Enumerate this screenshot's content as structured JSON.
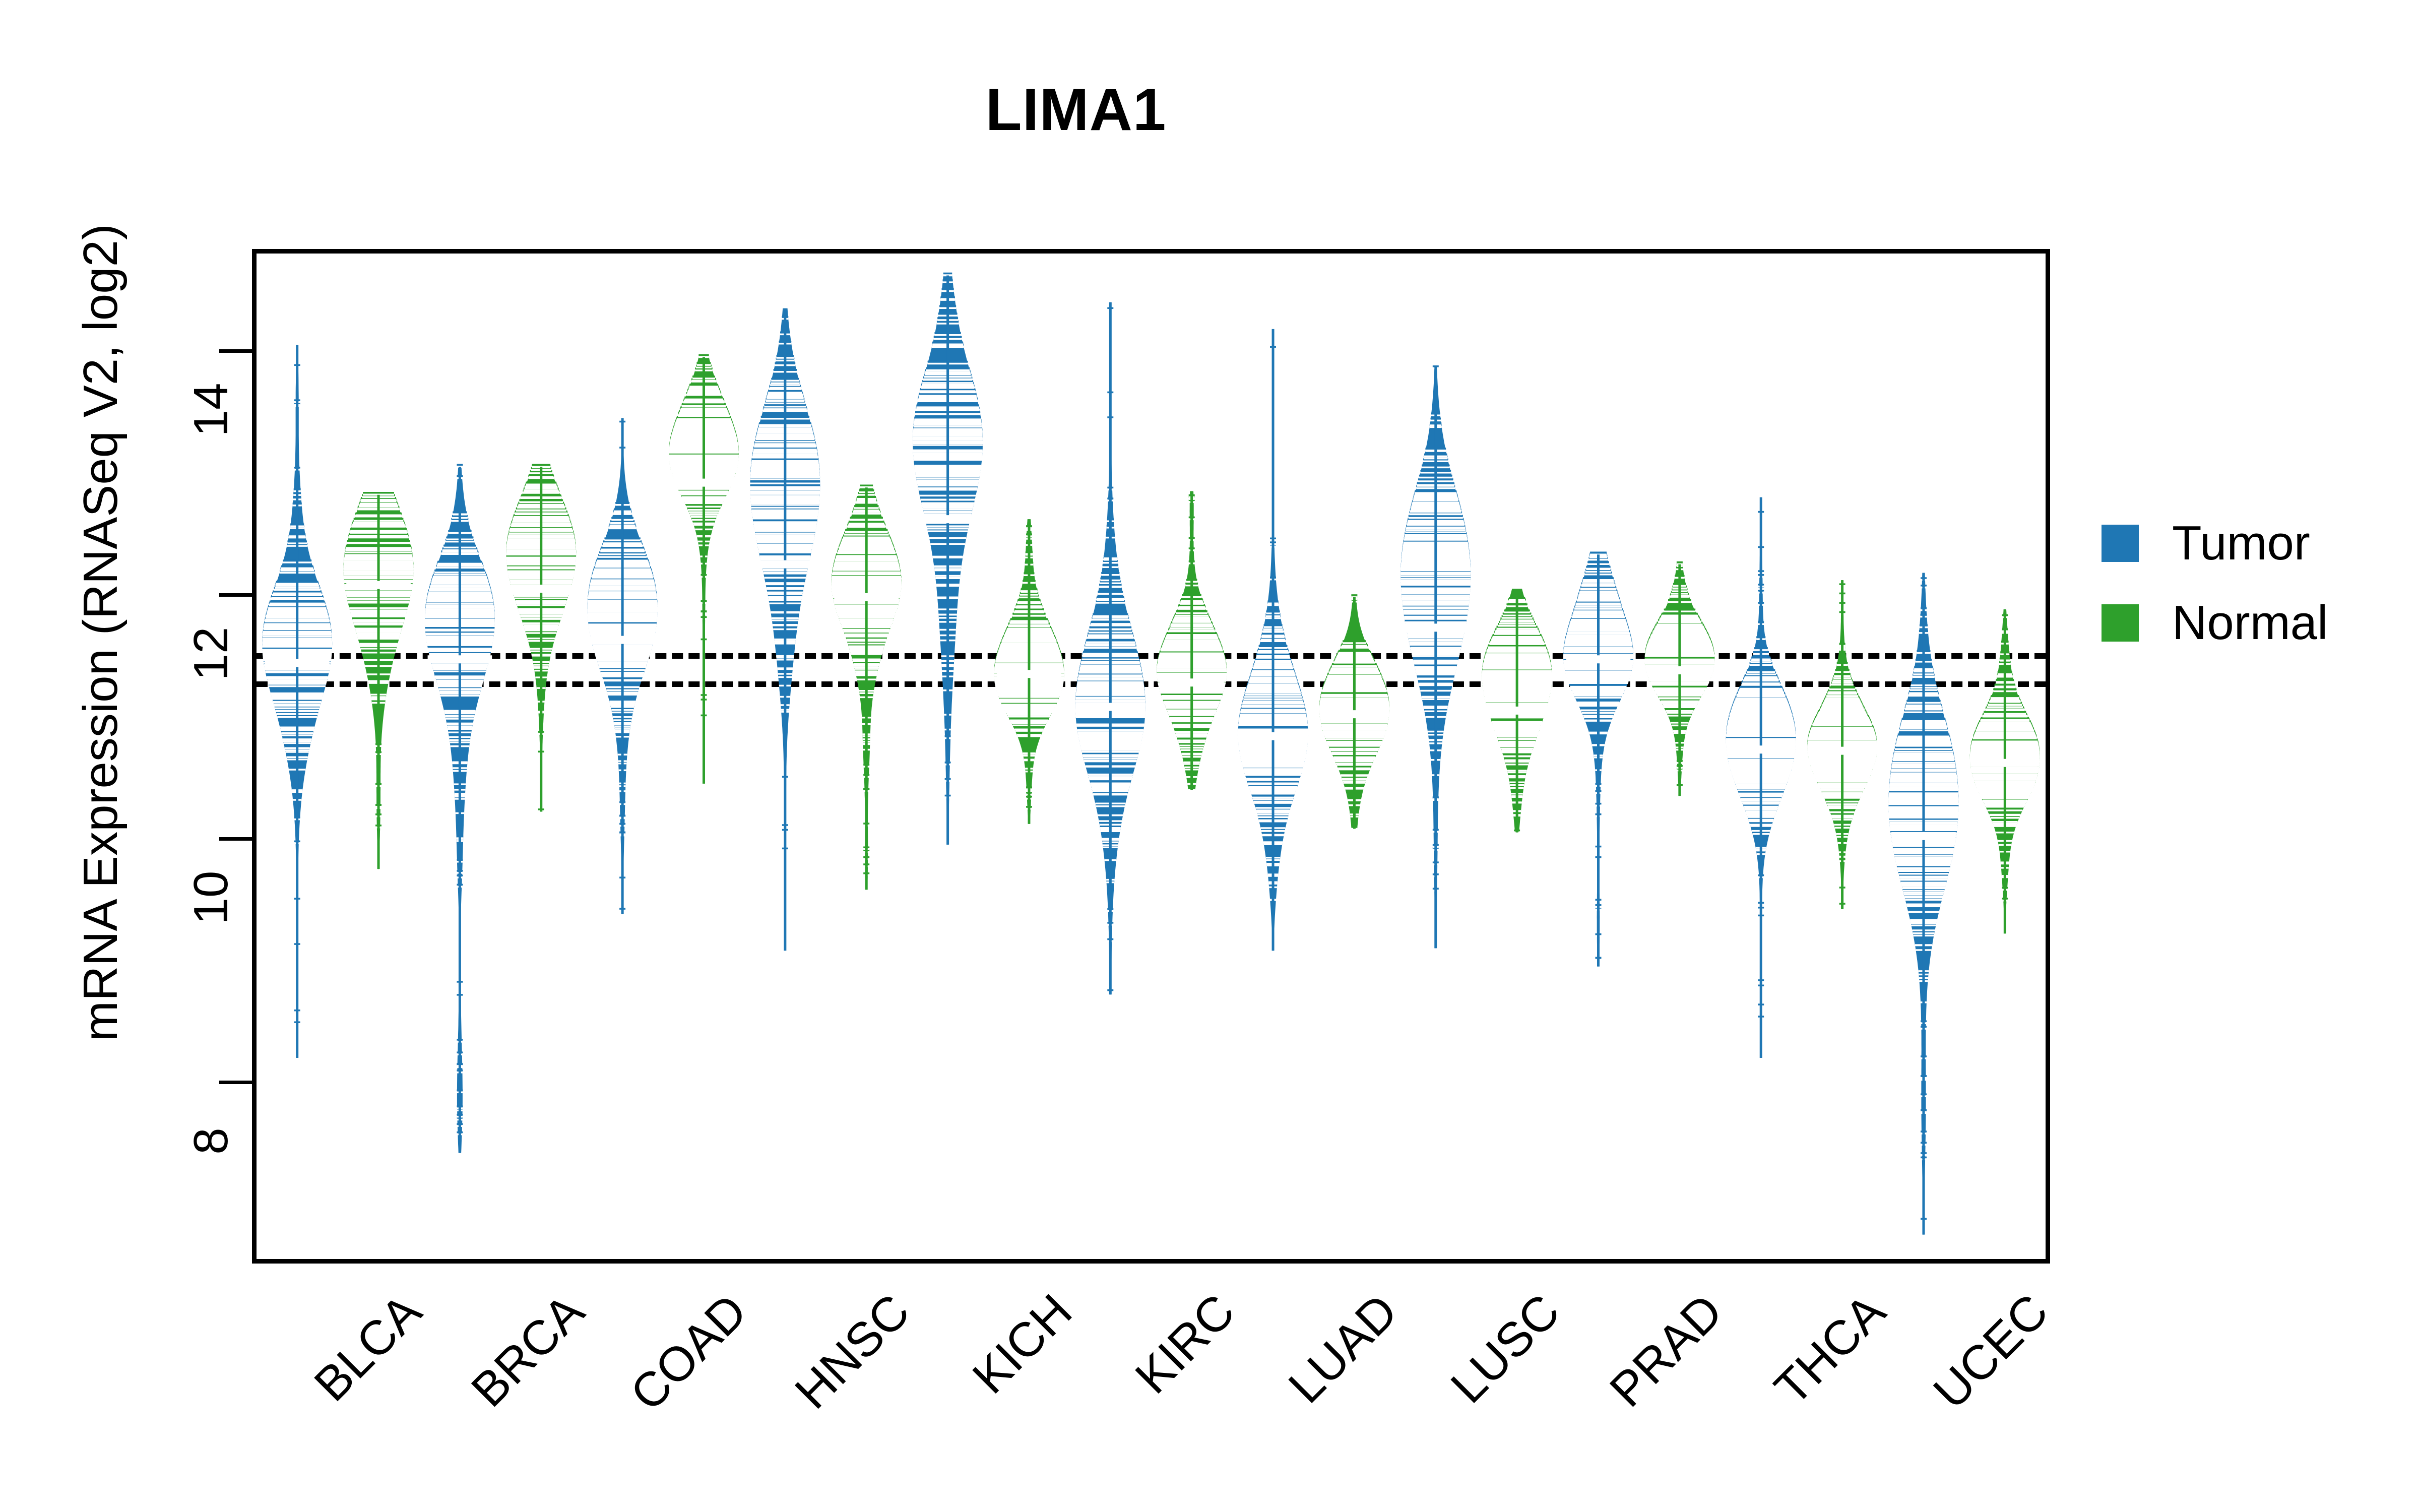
{
  "chart_data": {
    "type": "bar",
    "plot_style": "beanplot (split violin with individual observation strips)",
    "title": "LIMA1",
    "xlabel": "",
    "ylabel": "mRNA Expression (RNASeq V2, log2)",
    "ylim": [
      6.55,
      14.8
    ],
    "yticks": [
      8,
      10,
      12,
      14
    ],
    "ytick_labels": [
      "8",
      "10",
      "12",
      "14"
    ],
    "grid": false,
    "legend_position": "right",
    "reference_lines": [
      {
        "name": "overall-tumor-mean",
        "value": 11.52,
        "style": "dashed",
        "color": "#000000"
      },
      {
        "name": "overall-normal-mean",
        "value": 11.29,
        "style": "dashed",
        "color": "#000000"
      }
    ],
    "colors": {
      "tumor": "#1f77b4",
      "normal": "#2ea02c",
      "axis": "#000000",
      "background": "#ffffff"
    },
    "categories": [
      "BLCA",
      "BRCA",
      "COAD",
      "HNSC",
      "KICH",
      "KIRC",
      "LUAD",
      "LUSC",
      "PRAD",
      "THCA",
      "UCEC"
    ],
    "legend": [
      {
        "label": "Tumor",
        "color": "#1f77b4"
      },
      {
        "label": "Normal",
        "color": "#2ea02c"
      }
    ],
    "series": [
      {
        "name": "Tumor",
        "color": "#1f77b4",
        "stats": [
          {
            "category": "BLCA",
            "median": 11.44,
            "q1": 10.95,
            "q3": 11.95,
            "min": 8.2,
            "max": 14.05,
            "mode": 11.55
          },
          {
            "category": "BRCA",
            "median": 11.47,
            "q1": 11.05,
            "q3": 12.05,
            "min": 7.42,
            "max": 13.05,
            "mode": 11.8
          },
          {
            "category": "COAD",
            "median": 11.63,
            "q1": 11.15,
            "q3": 12.1,
            "min": 9.38,
            "max": 13.45,
            "mode": 11.9
          },
          {
            "category": "HNSC",
            "median": 12.25,
            "q1": 11.6,
            "q3": 12.85,
            "min": 9.08,
            "max": 14.35,
            "mode": 12.85
          },
          {
            "category": "KICH",
            "median": 12.62,
            "q1": 12.15,
            "q3": 13.4,
            "min": 9.95,
            "max": 14.62,
            "mode": 13.2
          },
          {
            "category": "KIRC",
            "median": 11.08,
            "q1": 10.55,
            "q3": 11.7,
            "min": 8.72,
            "max": 14.4,
            "mode": 11.1
          },
          {
            "category": "LUAD",
            "median": 10.84,
            "q1": 10.35,
            "q3": 11.4,
            "min": 9.08,
            "max": 14.18,
            "mode": 10.85
          },
          {
            "category": "LUSC",
            "median": 11.73,
            "q1": 11.1,
            "q3": 12.35,
            "min": 9.1,
            "max": 13.88,
            "mode": 12.1
          },
          {
            "category": "PRAD",
            "median": 11.47,
            "q1": 11.1,
            "q3": 11.85,
            "min": 8.95,
            "max": 12.33,
            "mode": 11.55
          },
          {
            "category": "THCA",
            "median": 10.73,
            "q1": 10.35,
            "q3": 11.15,
            "min": 8.2,
            "max": 12.8,
            "mode": 10.8
          },
          {
            "category": "UCEC",
            "median": 10.02,
            "q1": 9.45,
            "q3": 10.62,
            "min": 6.75,
            "max": 12.18,
            "mode": 10.35
          }
        ]
      },
      {
        "name": "Normal",
        "color": "#2ea02c",
        "stats": [
          {
            "category": "BLCA",
            "median": 12.08,
            "q1": 11.35,
            "q3": 12.35,
            "min": 9.75,
            "max": 12.82,
            "mode": 12.18
          },
          {
            "category": "BRCA",
            "median": 12.05,
            "q1": 11.65,
            "q3": 12.45,
            "min": 10.22,
            "max": 13.05,
            "mode": 12.35
          },
          {
            "category": "COAD",
            "median": 12.92,
            "q1": 12.62,
            "q3": 13.3,
            "min": 10.45,
            "max": 13.95,
            "mode": 13.22
          },
          {
            "category": "HNSC",
            "median": 11.98,
            "q1": 11.55,
            "q3": 12.35,
            "min": 9.58,
            "max": 12.88,
            "mode": 12.1
          },
          {
            "category": "KICH",
            "median": 11.35,
            "q1": 11.05,
            "q3": 11.75,
            "min": 10.12,
            "max": 12.62,
            "mode": 11.35
          },
          {
            "category": "KIRC",
            "median": 11.28,
            "q1": 10.95,
            "q3": 11.62,
            "min": 10.4,
            "max": 12.85,
            "mode": 11.35
          },
          {
            "category": "LUAD",
            "median": 11.02,
            "q1": 10.68,
            "q3": 11.4,
            "min": 10.08,
            "max": 11.98,
            "mode": 11.05
          },
          {
            "category": "LUSC",
            "median": 11.05,
            "q1": 10.72,
            "q3": 11.45,
            "min": 10.05,
            "max": 12.05,
            "mode": 11.3
          },
          {
            "category": "PRAD",
            "median": 11.38,
            "q1": 11.15,
            "q3": 11.72,
            "min": 10.35,
            "max": 12.25,
            "mode": 11.45
          },
          {
            "category": "THCA",
            "median": 10.72,
            "q1": 10.42,
            "q3": 11.05,
            "min": 9.42,
            "max": 12.12,
            "mode": 10.75
          },
          {
            "category": "UCEC",
            "median": 10.62,
            "q1": 10.3,
            "q3": 10.95,
            "min": 9.22,
            "max": 11.88,
            "mode": 10.65
          }
        ]
      }
    ]
  }
}
